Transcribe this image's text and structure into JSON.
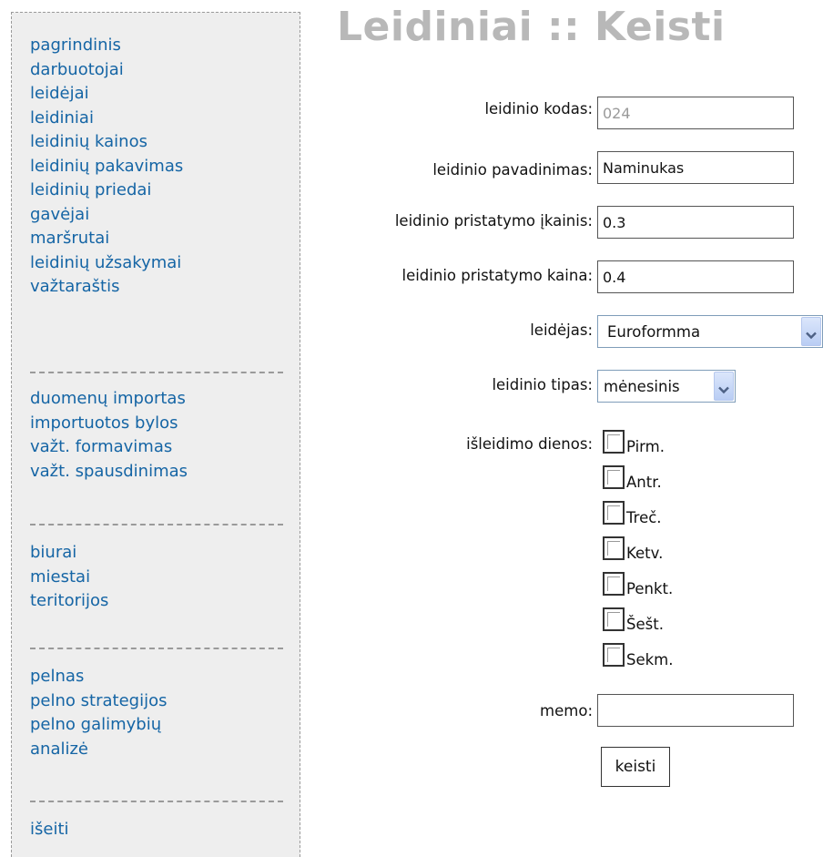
{
  "page": {
    "title": "Leidiniai :: Keisti"
  },
  "sidebar": {
    "groups": [
      [
        "pagrindinis",
        "darbuotojai",
        "leidėjai",
        "leidiniai",
        "leidinių kainos",
        "leidinių pakavimas",
        "leidinių priedai",
        "gavėjai",
        "maršrutai",
        "leidinių užsakymai",
        "važtaraštis"
      ],
      [
        "duomenų importas",
        "importuotos bylos",
        "važt. formavimas",
        "važt. spausdinimas"
      ],
      [
        "biurai",
        "miestai",
        "teritorijos"
      ],
      [
        "pelnas",
        "pelno strategijos",
        "pelno galimybių",
        "analizė"
      ],
      [
        "išeiti"
      ]
    ]
  },
  "form": {
    "code": {
      "label": "leidinio kodas:",
      "value": "024"
    },
    "name": {
      "label": "leidinio pavadinimas:",
      "value": "Naminukas"
    },
    "delivery_rate": {
      "label": "leidinio pristatymo įkainis:",
      "value": "0.3"
    },
    "delivery_price": {
      "label": "leidinio pristatymo kaina:",
      "value": "0.4"
    },
    "publisher": {
      "label": "leidėjas:",
      "value": "Euroformma"
    },
    "type": {
      "label": "leidinio tipas:",
      "value": "mėnesinis"
    },
    "release_days": {
      "label": "išleidimo dienos:",
      "days": [
        "Pirm.",
        "Antr.",
        "Treč.",
        "Ketv.",
        "Penkt.",
        "Šešt.",
        "Sekm."
      ]
    },
    "memo": {
      "label": "memo:",
      "value": ""
    },
    "submit_label": "keisti"
  }
}
